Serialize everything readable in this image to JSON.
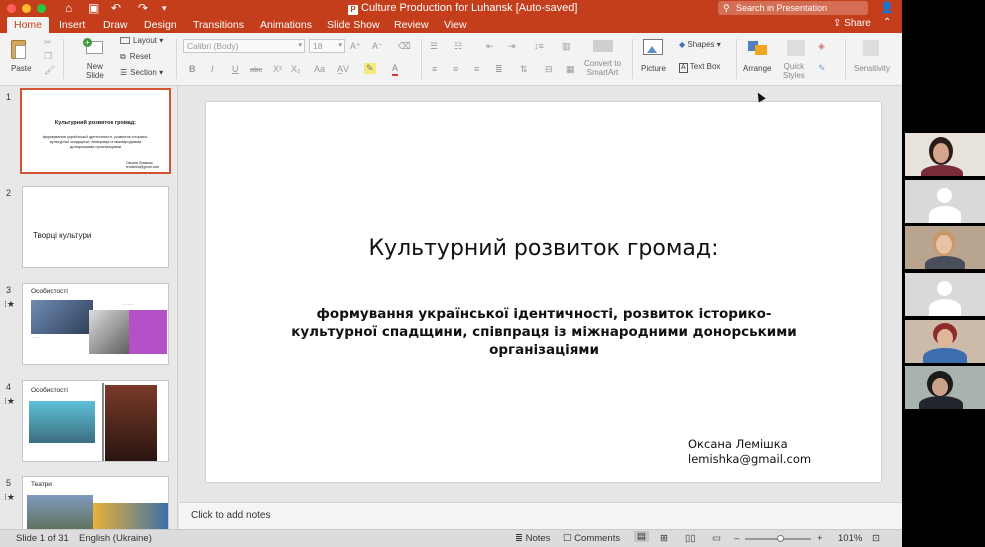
{
  "window": {
    "title": "Culture Production for Luhansk [Auto-saved]",
    "search_placeholder": "Search in Presentation"
  },
  "tabs": [
    {
      "label": "Home",
      "active": true
    },
    {
      "label": "Insert"
    },
    {
      "label": "Draw"
    },
    {
      "label": "Design"
    },
    {
      "label": "Transitions"
    },
    {
      "label": "Animations"
    },
    {
      "label": "Slide Show"
    },
    {
      "label": "Review"
    },
    {
      "label": "View"
    }
  ],
  "share_label": "Share",
  "ribbon": {
    "paste": "Paste",
    "new_slide": "New\nSlide",
    "layout": "Layout",
    "reset": "Reset",
    "section": "Section",
    "font_name": "Calibri (Body)",
    "font_size": "18",
    "convert_smartart": "Convert to\nSmartArt",
    "picture": "Picture",
    "shapes": "Shapes",
    "text_box": "Text Box",
    "arrange": "Arrange",
    "quick_styles": "Quick\nStyles",
    "sensitivity": "Sensitivity"
  },
  "slides": [
    {
      "number": "1",
      "title": "Культурний розвиток громад:",
      "subtitle": "формування української ідентичності, розвиток історико-культурної спадщини, співпраця із міжнародними донорськими організаціями",
      "author_name": "Оксана Лемішка",
      "author_email": "lemishka@gmail.com"
    },
    {
      "number": "2",
      "title": "Творці культури"
    },
    {
      "number": "3",
      "title": "Особистості"
    },
    {
      "number": "4",
      "title": "Особистості"
    },
    {
      "number": "5",
      "title": "Театри"
    }
  ],
  "notes_placeholder": "Click to add notes",
  "status": {
    "slide_position": "Slide 1 of 31",
    "language": "English (Ukraine)",
    "notes": "Notes",
    "comments": "Comments",
    "zoom": "101%",
    "zoom_fraction": 0.55
  },
  "accent_color": "#c43e1c"
}
